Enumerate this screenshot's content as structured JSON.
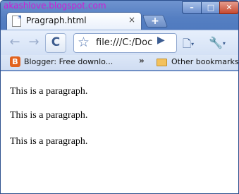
{
  "watermark": "akashlove.blogspot.com",
  "tab": {
    "title": "Pragraph.html",
    "close": "×"
  },
  "window_controls": {
    "minimize": "–",
    "maximize": "□",
    "close": "✕"
  },
  "newtab": {
    "label": "+"
  },
  "toolbar": {
    "back_icon": "←",
    "forward_icon": "→",
    "reload_icon": "C",
    "bookmark_star": "☆",
    "url": "file:///C:/Doc",
    "go_icon": "▶",
    "page_icon": "🗋",
    "wrench_icon": "🔧",
    "caret": "▾"
  },
  "bookmarks": {
    "item1": {
      "icon": "B",
      "label": "Blogger: Free downlo..."
    },
    "chevron": "»",
    "other": {
      "label": "Other bookmarks"
    }
  },
  "content": {
    "paragraphs": [
      "This is a paragraph.",
      "This is a paragraph.",
      "This is a paragraph."
    ]
  }
}
